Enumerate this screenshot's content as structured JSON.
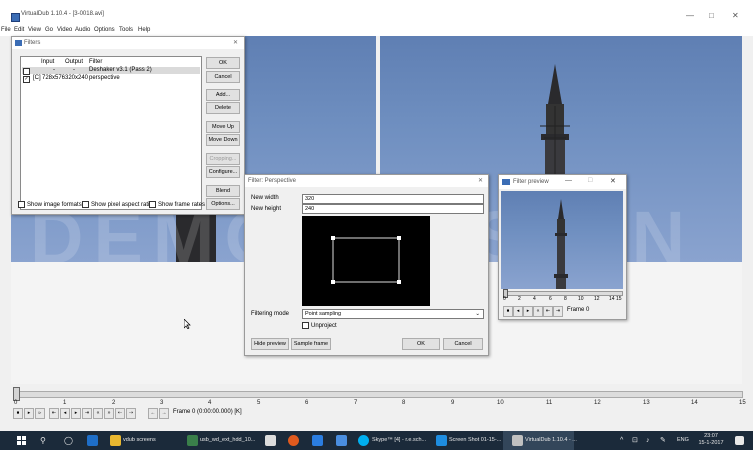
{
  "window": {
    "title": "VirtualDub 1.10.4 - [3-0018.avi]",
    "minimize": "—",
    "maximize": "□",
    "close": "✕"
  },
  "menu": [
    "File",
    "Edit",
    "View",
    "Go",
    "Video",
    "Audio",
    "Options",
    "Tools",
    "Help"
  ],
  "filters_dialog": {
    "title": "Filters",
    "close": "✕",
    "columns": [
      "Input",
      "Output",
      "Filter"
    ],
    "rows": [
      {
        "checked": false,
        "flag": "",
        "input": "-",
        "output": "-",
        "filter": "Deshaker v3.1 (Pass 2)"
      },
      {
        "checked": true,
        "flag": "[C]",
        "input": "728x576",
        "output": "320x240",
        "filter": "perspective"
      }
    ],
    "buttons": {
      "ok": "OK",
      "cancel": "Cancel",
      "add": "Add...",
      "delete": "Delete",
      "move_up": "Move Up",
      "move_down": "Move Down",
      "cropping": "Cropping...",
      "configure": "Configure...",
      "blend": "Blend",
      "options": "Options..."
    },
    "checkboxes": {
      "image_formats": "Show image formats",
      "pixel_aspect": "Show pixel aspect ratios",
      "frame_rates": "Show frame rates"
    }
  },
  "perspective_dialog": {
    "title": "Filter: Perspective",
    "close": "✕",
    "new_width_label": "New width",
    "new_width": "320",
    "new_height_label": "New height",
    "new_height": "240",
    "filtering_mode_label": "Filtering mode",
    "filtering_mode": "Point sampling",
    "unproject": "Unproject",
    "buttons": {
      "hide_preview": "Hide preview",
      "sample_frame": "Sample frame",
      "ok": "OK",
      "cancel": "Cancel"
    }
  },
  "preview_dialog": {
    "title": "Filter preview",
    "minimize": "—",
    "maximize": "□",
    "close": "✕",
    "ticks": [
      "0",
      "2",
      "4",
      "6",
      "8",
      "10",
      "12",
      "14",
      "15"
    ],
    "frame": "Frame 0"
  },
  "timeline": {
    "ticks": [
      "0",
      "1",
      "2",
      "3",
      "4",
      "5",
      "6",
      "7",
      "8",
      "9",
      "10",
      "11",
      "12",
      "13",
      "14",
      "15"
    ],
    "frame_label": "Frame 0 (0:00:00.000) [K]"
  },
  "watermark": "DEMOVERSION",
  "taskbar": {
    "items": [
      "vdub screens",
      "usb_wd_ext_hdd_10...",
      "Skype™ [4] - r.e.sch...",
      "Screen Shot 01-15-...",
      "VirtualDub 1.10.4 - ..."
    ],
    "lang": "ENG",
    "time": "23:07",
    "date": "15-1-2017"
  },
  "colors": {
    "sky": "#6f8fc0",
    "taskbar": "#1b2a3a",
    "accent": "#0078d7"
  }
}
